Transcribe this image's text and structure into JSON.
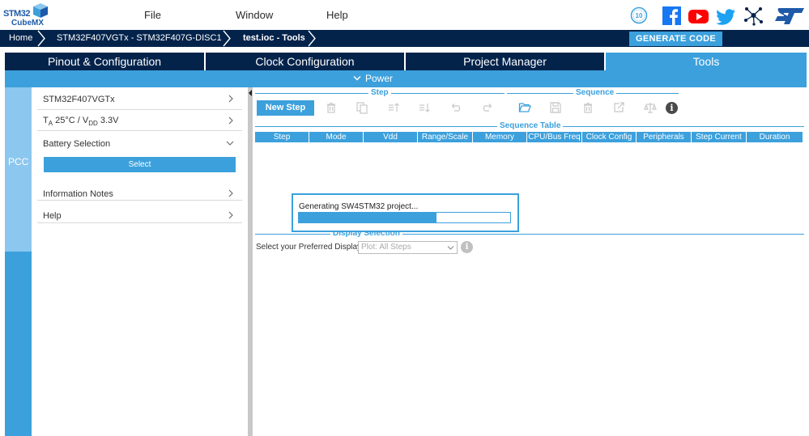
{
  "app": {
    "logo_top": "STM32",
    "logo_bottom": "CubeMX"
  },
  "menu": {
    "items": [
      "File",
      "Window",
      "Help"
    ]
  },
  "social": {
    "icons": [
      "anniversary-10-icon",
      "facebook-icon",
      "youtube-icon",
      "twitter-icon",
      "network-icon",
      "st-logo-icon"
    ],
    "anniversary_text": "10"
  },
  "breadcrumb": {
    "items": [
      "Home",
      "STM32F407VGTx  -  STM32F407G-DISC1",
      "test.ioc - Tools"
    ]
  },
  "generate_button": "GENERATE CODE",
  "tabs": [
    {
      "label": "Pinout & Configuration",
      "active": false
    },
    {
      "label": "Clock Configuration",
      "active": false
    },
    {
      "label": "Project Manager",
      "active": false
    },
    {
      "label": "Tools",
      "active": true
    }
  ],
  "power": {
    "label": "Power"
  },
  "side": {
    "pcc_label": "PCC"
  },
  "left_panel": {
    "mcu": "STM32F407VGTx",
    "temp_t": "T",
    "temp_sub": "A",
    "temp_mid": " 25°C / V",
    "temp_sub2": "DD",
    "temp_end": " 3.3V",
    "battery": "Battery Selection",
    "select_button": "Select",
    "info_notes": "Information Notes",
    "help": "Help"
  },
  "step_group": {
    "label": "Step",
    "new_step": "New Step"
  },
  "sequence_group": {
    "label": "Sequence"
  },
  "sequence_table": {
    "label": "Sequence Table",
    "columns": [
      "Step",
      "Mode",
      "Vdd",
      "Range/Scale",
      "Memory",
      "CPU/Bus Freq",
      "Clock Config",
      "Peripherals",
      "Step Current",
      "Duration"
    ]
  },
  "progress": {
    "message": "Generating SW4STM32 project...",
    "fraction": 0.65
  },
  "display_selection": {
    "label": "Display Selection",
    "prompt": "Select your Preferred Display",
    "selected": "Plot: All Steps"
  },
  "colors": {
    "navy": "#03234b",
    "accent": "#3ca0dc",
    "light_accent": "#8cc7ef"
  }
}
